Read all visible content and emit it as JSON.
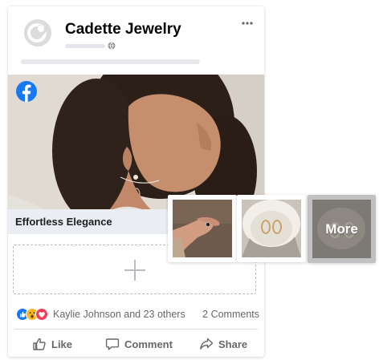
{
  "post": {
    "page_name": "Cadette Jewelry",
    "caption": "Effortless Elegance"
  },
  "engagement": {
    "reacted_by": "Kaylie Johnson and 23 others",
    "comments": "2 Comments"
  },
  "actions": {
    "like": "Like",
    "comment": "Comment",
    "share": "Share"
  },
  "gallery": {
    "more_label": "More"
  },
  "colors": {
    "facebook_blue": "#1877f2",
    "text_primary": "#050505",
    "text_secondary": "#65676b",
    "caption_bar": "#eaedf1"
  },
  "icons": [
    "facebook-logo-icon",
    "globe-icon",
    "more-options-icon",
    "plus-icon",
    "like-reaction-icon",
    "wow-reaction-icon",
    "love-reaction-icon",
    "thumbs-up-icon",
    "comment-icon",
    "share-icon"
  ]
}
